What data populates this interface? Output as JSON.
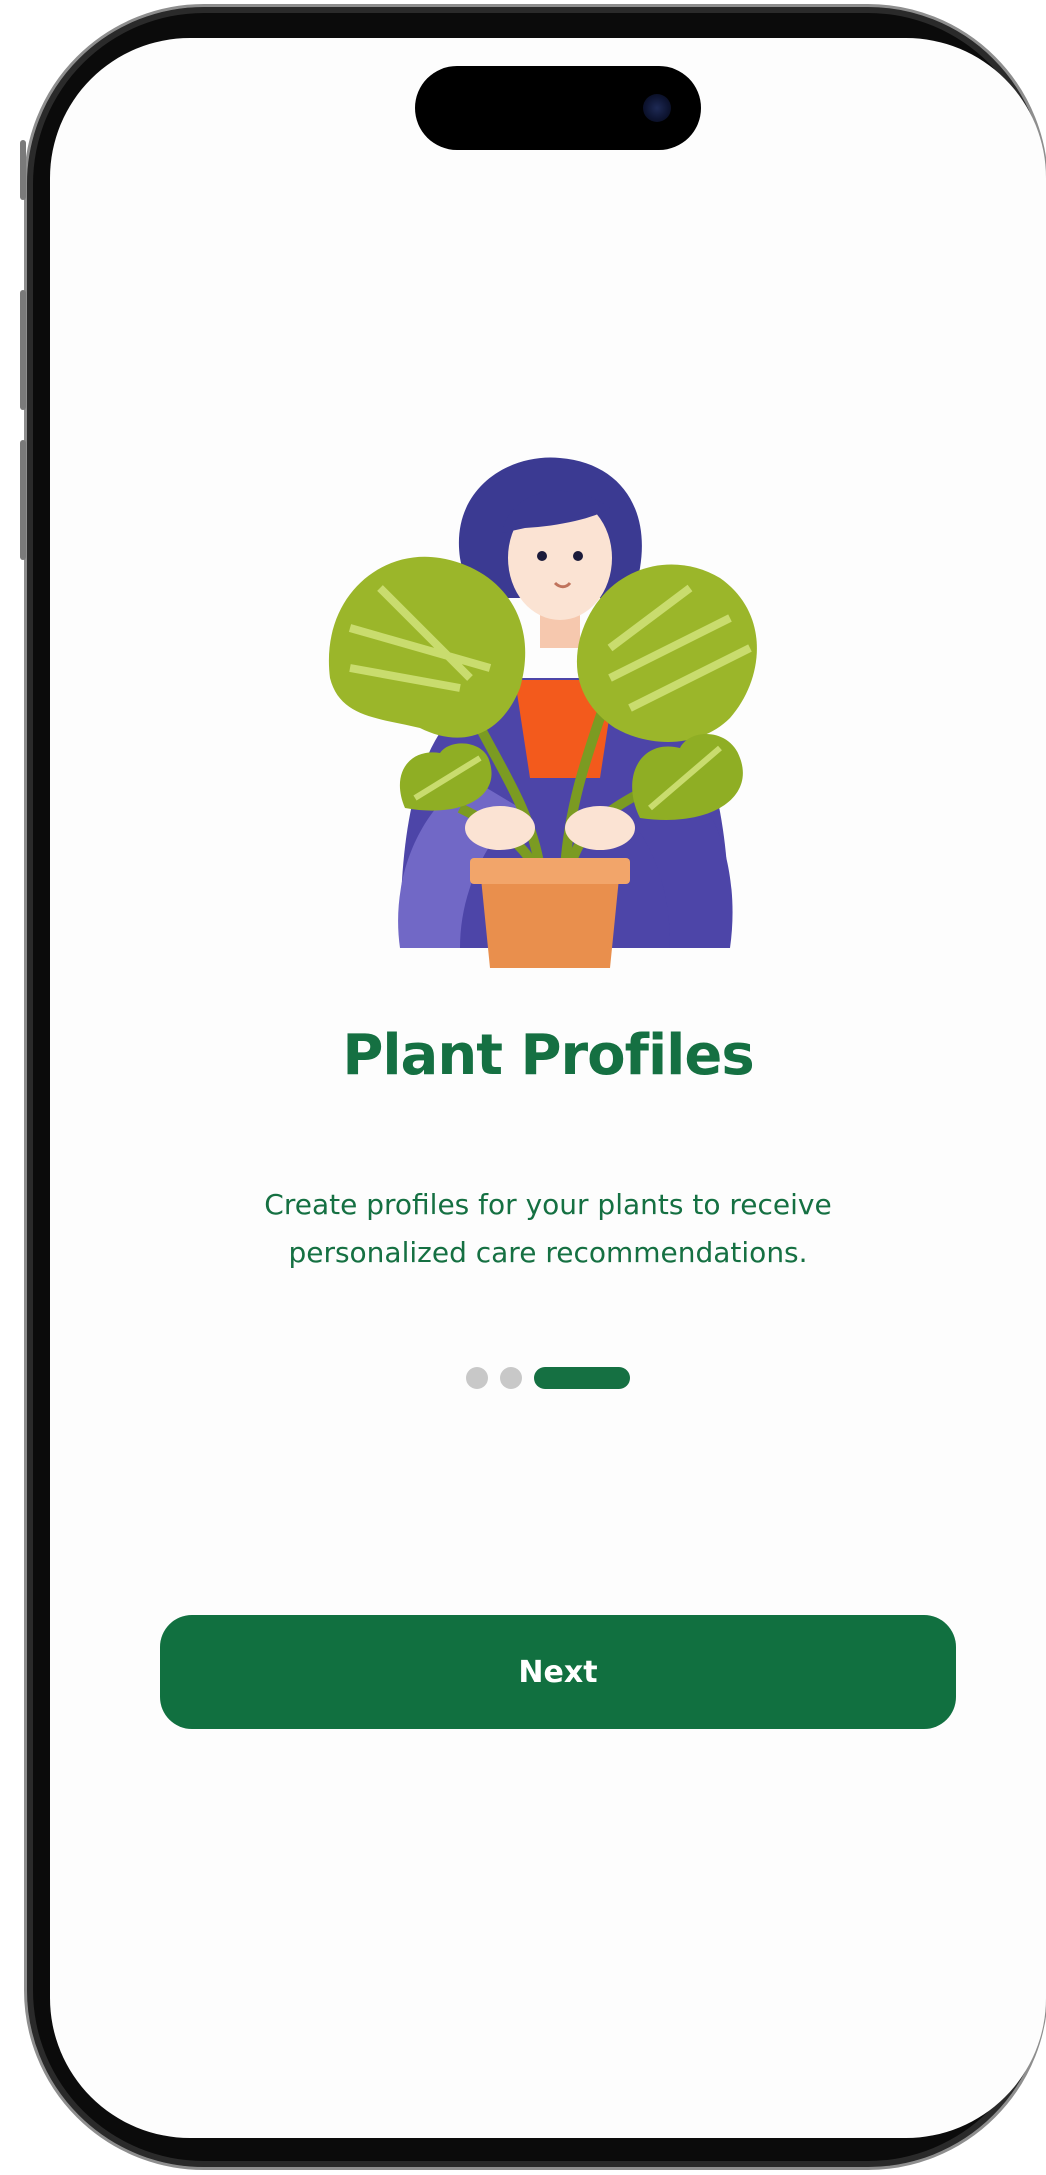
{
  "onboarding": {
    "title": "Plant Profiles",
    "description": "Create profiles for your plants to receive personalized care recommendations.",
    "pager": {
      "total": 3,
      "current": 3
    },
    "next_label": "Next"
  },
  "illustration": {
    "icon": "person-holding-plant-illustration"
  },
  "colors": {
    "primary": "#117040",
    "text": "#157042",
    "pager_inactive": "#c8c8c8",
    "leaf": "#9bb62a",
    "leaf_dark": "#6f8d1c",
    "hair": "#3b3a92",
    "sweater": "#5e56b8",
    "shirt": "#f35a1c",
    "pot": "#e98f4d",
    "skin": "#fbe3d3"
  }
}
